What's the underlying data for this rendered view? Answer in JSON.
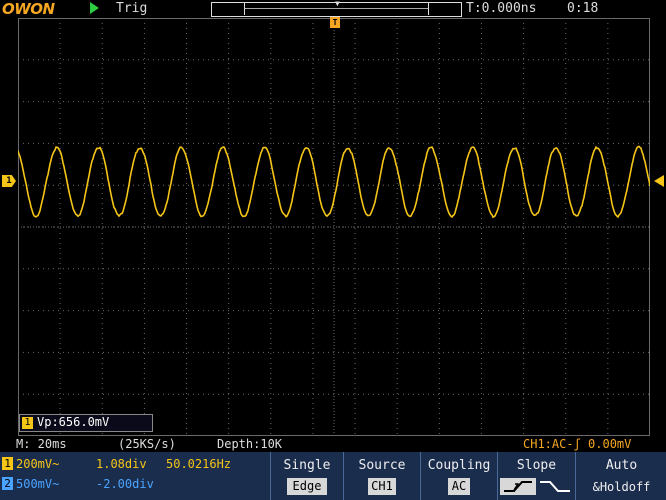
{
  "top": {
    "logo": "OWON",
    "trigger_state": "Trig",
    "time_offset": "T:0.000ns",
    "clock": "0:18"
  },
  "markers": {
    "trigger": "T",
    "channel1": "1"
  },
  "measurement": {
    "channel": "1",
    "text": "Vp:656.0mV"
  },
  "status": {
    "timebase": "M: 20ms",
    "sample_rate": "(25KS/s)",
    "depth": "Depth:10K",
    "trigger_info": "CH1:AC-ʃ 0.00mV"
  },
  "channels": [
    {
      "num": "1",
      "volts": "200mV~",
      "position": "1.08div",
      "freq": "50.0216Hz",
      "color": "#f5c518"
    },
    {
      "num": "2",
      "volts": "500mV~",
      "position": "-2.00div",
      "freq": "",
      "color": "#4aa3ff"
    }
  ],
  "menu": {
    "single": {
      "label": "Single",
      "value": "Edge"
    },
    "source": {
      "label": "Source",
      "value": "CH1"
    },
    "coupling": {
      "label": "Coupling",
      "value": "AC"
    },
    "slope": {
      "label": "Slope"
    },
    "auto": {
      "label": "Auto",
      "sub": "&Holdoff"
    }
  },
  "colors": {
    "ch1": "#f5c518",
    "ch2": "#4aa3ff",
    "grid": "#6a6a6a",
    "menu_bg": "#1b2d4d",
    "logo": "#f5a623"
  },
  "waveform": {
    "cycles_on_screen": 15.2,
    "amplitude_div": 1.64,
    "offset_div": 1.08
  }
}
